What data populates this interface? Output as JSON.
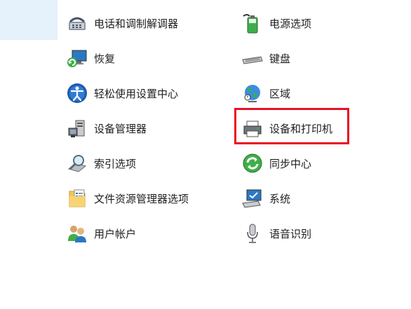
{
  "left_column": [
    {
      "label": "电话和调制解调器",
      "icon": "phone-modem-icon"
    },
    {
      "label": "恢复",
      "icon": "recovery-icon"
    },
    {
      "label": "轻松使用设置中心",
      "icon": "ease-of-access-icon"
    },
    {
      "label": "设备管理器",
      "icon": "device-manager-icon"
    },
    {
      "label": "索引选项",
      "icon": "indexing-options-icon"
    },
    {
      "label": "文件资源管理器选项",
      "icon": "folder-options-icon"
    },
    {
      "label": "用户帐户",
      "icon": "user-accounts-icon"
    }
  ],
  "right_column": [
    {
      "label": "电源选项",
      "icon": "power-options-icon"
    },
    {
      "label": "键盘",
      "icon": "keyboard-icon"
    },
    {
      "label": "区域",
      "icon": "region-globe-icon"
    },
    {
      "label": "设备和打印机",
      "icon": "devices-printers-icon"
    },
    {
      "label": "同步中心",
      "icon": "sync-center-icon"
    },
    {
      "label": "系统",
      "icon": "system-monitor-icon"
    },
    {
      "label": "语音识别",
      "icon": "microphone-icon"
    }
  ],
  "colors": {
    "highlight": "#e81123",
    "sidebar_selected": "#e5f1fb"
  }
}
